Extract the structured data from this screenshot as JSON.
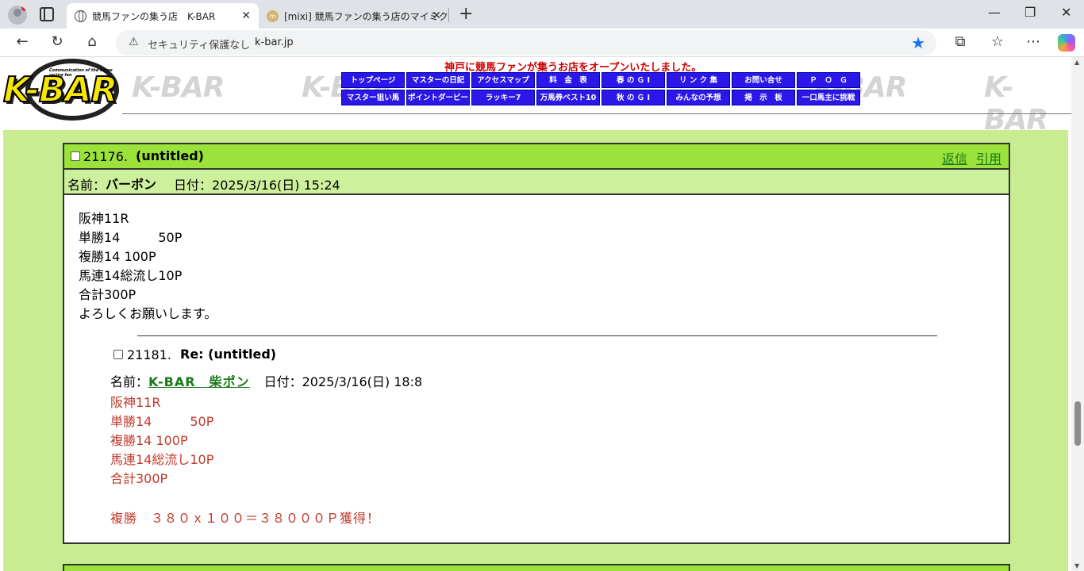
{
  "browser": {
    "tabs": [
      {
        "title": "競馬ファンの集う店　K-BAR",
        "icon": "globe-icon",
        "active": true
      },
      {
        "title": "[mixi] 競馬ファンの集う店のマイミクシィ",
        "icon": "mixi-icon",
        "active": false
      }
    ],
    "address": {
      "security_label": "セキュリティ保護なし",
      "url": "k-bar.jp"
    }
  },
  "site": {
    "logo_text": "K-BAR",
    "logo_tagline": "Communication of the horse racing fan",
    "watermark": "K-BAR",
    "banner": "神戸に競馬ファンが集うお店をオープンいたしました。",
    "nav_row1": [
      "トップページ",
      "マスターの日記",
      "アクセスマップ",
      "料　金　表",
      "春 の Ｇ Ⅰ",
      "リ ン ク 集",
      "お問い合せ",
      "Ｐ　Ｏ　Ｇ"
    ],
    "nav_row2": [
      "マスター狙い馬",
      "ポイントダービー",
      "ラッキー7",
      "万馬券ベスト10",
      "秋 の Ｇ Ⅰ",
      "みんなの予想",
      "掲　示　板",
      "一口馬主に挑戦"
    ]
  },
  "post": {
    "number": "21176.",
    "title": "(untitled)",
    "reply_link": "返信",
    "quote_link": "引用",
    "name_label": "名前：",
    "name": "バーボン",
    "date_label": "日付：",
    "date": "2025/3/16(日) 15:24",
    "lines": [
      "阪神11R",
      "単勝14　　　50P",
      "複勝14 100P",
      "馬連14総流し10P",
      "合計300P",
      "よろしくお願いします。"
    ],
    "reply": {
      "number": "21181.",
      "title": "Re: (untitled)",
      "name_label": "名前：",
      "name": "K-BAR　柴ポン",
      "date_label": "日付：",
      "date": "2025/3/16(日) 18:8",
      "lines": [
        "阪神11R",
        "単勝14　　　50P",
        "複勝14 100P",
        "馬連14総流し10P",
        "合計300P"
      ],
      "result": "複勝　３８０ｘ１００＝３８０００Ｐ獲得！"
    }
  }
}
